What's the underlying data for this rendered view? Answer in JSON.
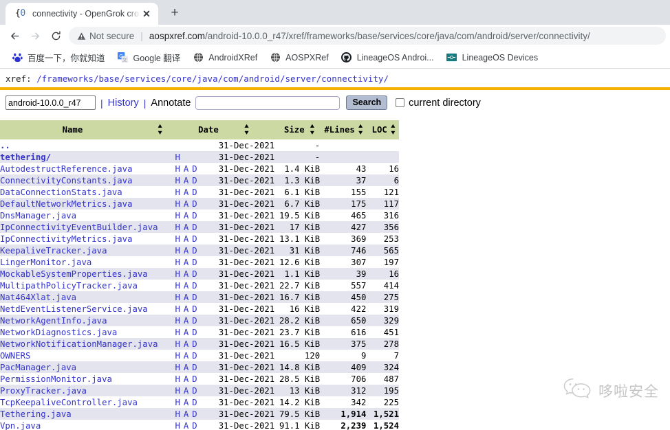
{
  "browser": {
    "tab": {
      "favicon": "{0",
      "title": "connectivity - OpenGrok cross",
      "close": "✕"
    },
    "new_tab_label": "+",
    "nav": {
      "back": "←",
      "forward": "→",
      "reload": "⟳"
    },
    "omnibox": {
      "security_label": "Not secure",
      "divider": "|",
      "url_domain": "aospxref.com",
      "url_path": "/android-10.0.0_r47/xref/frameworks/base/services/core/java/com/android/server/connectivity/"
    },
    "bookmarks": [
      {
        "label": "百度一下，你就知道",
        "icon": "baidu-icon"
      },
      {
        "label": "Google 翻译",
        "icon": "google-translate-icon"
      },
      {
        "label": "AndroidXRef",
        "icon": "globe-icon"
      },
      {
        "label": "AOSPXRef",
        "icon": "globe-icon"
      },
      {
        "label": "LineageOS Androi...",
        "icon": "github-icon"
      },
      {
        "label": "LineageOS Devices",
        "icon": "device-icon"
      }
    ]
  },
  "opengrok": {
    "xref_prefix": "xref: ",
    "breadcrumb": [
      "/frameworks",
      "/base",
      "/services",
      "/core",
      "/java",
      "/com",
      "/android",
      "/server",
      "/connectivity/"
    ],
    "project": "android-10.0.0_r47",
    "history_label": "History",
    "annotate_label": "Annotate",
    "search_value": "",
    "search_placeholder": "",
    "search_button": "Search",
    "current_directory_label": "current directory",
    "columns": [
      "Name",
      "Date",
      "Size",
      "#Lines",
      "LOC"
    ],
    "accent_bar_color": "#f5b301",
    "header_bg_color": "#cdd9a3",
    "alt_row_color": "#e4e4ee",
    "link_color": "#3333cc",
    "rows": [
      {
        "name": "..",
        "is_dir": true,
        "links": "",
        "date": "31-Dec-2021",
        "size": "-",
        "lines": "",
        "loc": ""
      },
      {
        "name": "tethering/",
        "is_dir": true,
        "links": "H",
        "date": "31-Dec-2021",
        "size": "-",
        "lines": "",
        "loc": ""
      },
      {
        "name": "AutodestructReference.java",
        "is_dir": false,
        "links": "H A D",
        "date": "31-Dec-2021",
        "size": "1.4 KiB",
        "lines": "43",
        "loc": "16"
      },
      {
        "name": "ConnectivityConstants.java",
        "is_dir": false,
        "links": "H A D",
        "date": "31-Dec-2021",
        "size": "1.3 KiB",
        "lines": "37",
        "loc": "6"
      },
      {
        "name": "DataConnectionStats.java",
        "is_dir": false,
        "links": "H A D",
        "date": "31-Dec-2021",
        "size": "6.1 KiB",
        "lines": "155",
        "loc": "121"
      },
      {
        "name": "DefaultNetworkMetrics.java",
        "is_dir": false,
        "links": "H A D",
        "date": "31-Dec-2021",
        "size": "6.7 KiB",
        "lines": "175",
        "loc": "117"
      },
      {
        "name": "DnsManager.java",
        "is_dir": false,
        "links": "H A D",
        "date": "31-Dec-2021",
        "size": "19.5 KiB",
        "lines": "465",
        "loc": "316"
      },
      {
        "name": "IpConnectivityEventBuilder.java",
        "is_dir": false,
        "links": "H A D",
        "date": "31-Dec-2021",
        "size": "17 KiB",
        "lines": "427",
        "loc": "356"
      },
      {
        "name": "IpConnectivityMetrics.java",
        "is_dir": false,
        "links": "H A D",
        "date": "31-Dec-2021",
        "size": "13.1 KiB",
        "lines": "369",
        "loc": "253"
      },
      {
        "name": "KeepaliveTracker.java",
        "is_dir": false,
        "links": "H A D",
        "date": "31-Dec-2021",
        "size": "31 KiB",
        "lines": "746",
        "loc": "565"
      },
      {
        "name": "LingerMonitor.java",
        "is_dir": false,
        "links": "H A D",
        "date": "31-Dec-2021",
        "size": "12.6 KiB",
        "lines": "307",
        "loc": "197"
      },
      {
        "name": "MockableSystemProperties.java",
        "is_dir": false,
        "links": "H A D",
        "date": "31-Dec-2021",
        "size": "1.1 KiB",
        "lines": "39",
        "loc": "16"
      },
      {
        "name": "MultipathPolicyTracker.java",
        "is_dir": false,
        "links": "H A D",
        "date": "31-Dec-2021",
        "size": "22.7 KiB",
        "lines": "557",
        "loc": "414"
      },
      {
        "name": "Nat464Xlat.java",
        "is_dir": false,
        "links": "H A D",
        "date": "31-Dec-2021",
        "size": "16.7 KiB",
        "lines": "450",
        "loc": "275"
      },
      {
        "name": "NetdEventListenerService.java",
        "is_dir": false,
        "links": "H A D",
        "date": "31-Dec-2021",
        "size": "16 KiB",
        "lines": "422",
        "loc": "319"
      },
      {
        "name": "NetworkAgentInfo.java",
        "is_dir": false,
        "links": "H A D",
        "date": "31-Dec-2021",
        "size": "28.2 KiB",
        "lines": "650",
        "loc": "329"
      },
      {
        "name": "NetworkDiagnostics.java",
        "is_dir": false,
        "links": "H A D",
        "date": "31-Dec-2021",
        "size": "23.7 KiB",
        "lines": "616",
        "loc": "451"
      },
      {
        "name": "NetworkNotificationManager.java",
        "is_dir": false,
        "links": "H A D",
        "date": "31-Dec-2021",
        "size": "16.5 KiB",
        "lines": "375",
        "loc": "278"
      },
      {
        "name": "OWNERS",
        "is_dir": false,
        "links": "H A D",
        "date": "31-Dec-2021",
        "size": "120",
        "lines": "9",
        "loc": "7"
      },
      {
        "name": "PacManager.java",
        "is_dir": false,
        "links": "H A D",
        "date": "31-Dec-2021",
        "size": "14.8 KiB",
        "lines": "409",
        "loc": "324"
      },
      {
        "name": "PermissionMonitor.java",
        "is_dir": false,
        "links": "H A D",
        "date": "31-Dec-2021",
        "size": "28.5 KiB",
        "lines": "706",
        "loc": "487"
      },
      {
        "name": "ProxyTracker.java",
        "is_dir": false,
        "links": "H A D",
        "date": "31-Dec-2021",
        "size": "13 KiB",
        "lines": "312",
        "loc": "195"
      },
      {
        "name": "TcpKeepaliveController.java",
        "is_dir": false,
        "links": "H A D",
        "date": "31-Dec-2021",
        "size": "14.2 KiB",
        "lines": "342",
        "loc": "225"
      },
      {
        "name": "Tethering.java",
        "is_dir": false,
        "links": "H A D",
        "date": "31-Dec-2021",
        "size": "79.5 KiB",
        "lines": "1,914",
        "loc": "1,521"
      },
      {
        "name": "Vpn.java",
        "is_dir": false,
        "links": "H A D",
        "date": "31-Dec-2021",
        "size": "91.1 KiB",
        "lines": "2,239",
        "loc": "1,524"
      }
    ]
  },
  "watermark": {
    "text": "哆啦安全",
    "icon": "wechat-icon"
  }
}
